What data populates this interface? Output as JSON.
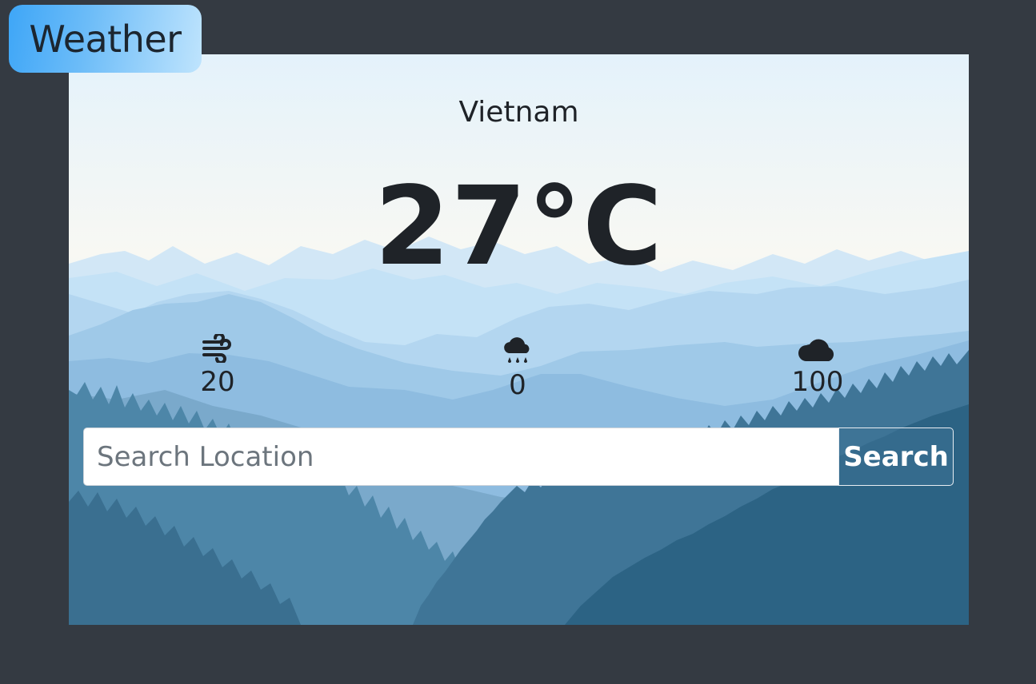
{
  "app": {
    "title": "Weather"
  },
  "weather": {
    "location": "Vietnam",
    "temperature": "27°C",
    "wind": "20",
    "rain": "0",
    "clouds": "100"
  },
  "search": {
    "placeholder": "Search Location",
    "value": "",
    "button_label": "Search"
  },
  "icons": {
    "wind": "wind-icon",
    "rain": "cloud-rain-icon",
    "clouds": "cloud-icon"
  },
  "colors": {
    "page_background": "#343a42",
    "badge_gradient_start": "#3ea6f7",
    "badge_gradient_end": "#bfe4fd",
    "text_dark": "#1f2328"
  }
}
